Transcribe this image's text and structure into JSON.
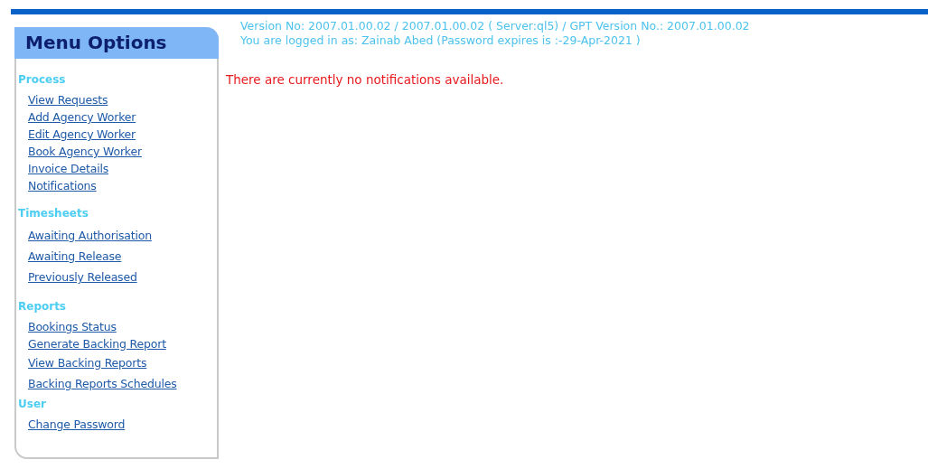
{
  "menu": {
    "title": "Menu Options",
    "sections": [
      {
        "heading": "Process",
        "links": [
          "View Requests",
          "Add Agency Worker",
          "Edit Agency Worker",
          "Book Agency Worker",
          "Invoice Details",
          "Notifications"
        ]
      },
      {
        "heading": "Timesheets",
        "links": [
          "Awaiting Authorisation",
          "Awaiting Release",
          "Previously Released"
        ]
      },
      {
        "heading": "Reports",
        "links": [
          "Bookings Status",
          "Generate Backing Report",
          "View Backing Reports",
          "Backing Reports Schedules"
        ]
      },
      {
        "heading": "User",
        "links": [
          "Change Password"
        ]
      }
    ]
  },
  "version_line": "Version No: 2007.01.00.02 / 2007.01.00.02 ( Server:ql5) / GPT Version No.: 2007.01.00.02",
  "login_line": "You are logged in as: Zainab Abed (Password expires is :-29-Apr-2021 )",
  "message": "There are currently no notifications available."
}
